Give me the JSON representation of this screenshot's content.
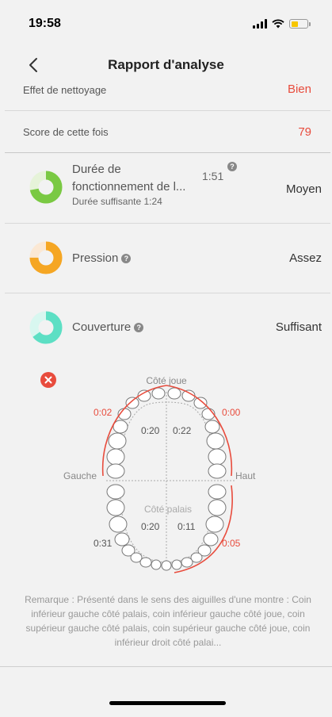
{
  "status_bar": {
    "time": "19:58"
  },
  "nav": {
    "title": "Rapport d'analyse"
  },
  "summary": {
    "cleaning_label": "Effet de nettoyage",
    "cleaning_value": "Bien",
    "score_label": "Score de cette fois",
    "score_value": "79"
  },
  "metrics": {
    "duration": {
      "label": "Durée de fonctionnement de l...",
      "time": "1:51",
      "sub": "Durée suffisante 1:24",
      "value": "Moyen",
      "color": "#7ac943",
      "fraction": 0.72
    },
    "pressure": {
      "label": "Pression",
      "value": "Assez",
      "color": "#f5a623",
      "fraction": 0.75
    },
    "coverage": {
      "label": "Couverture",
      "value": "Suffisant",
      "color": "#5ddfc4",
      "fraction": 0.65
    }
  },
  "diagram": {
    "label_top": "Côté joue",
    "label_left": "Gauche",
    "label_right": "Haut",
    "label_center": "Côté palais",
    "outer_top_left": "0:02",
    "outer_top_right": "0:00",
    "inner_top_left": "0:20",
    "inner_top_right": "0:22",
    "inner_bottom_left": "0:20",
    "inner_bottom_right": "0:11",
    "outer_bottom_left": "0:31",
    "outer_bottom_right": "0:05",
    "accent": "#e84c3d"
  },
  "remark": "Remarque : Présenté dans le sens des aiguilles d'une montre : Coin inférieur gauche côté palais, coin inférieur gauche côté joue, coin supérieur gauche côté palais, coin supérieur gauche côté joue, coin inférieur droit côté palai..."
}
